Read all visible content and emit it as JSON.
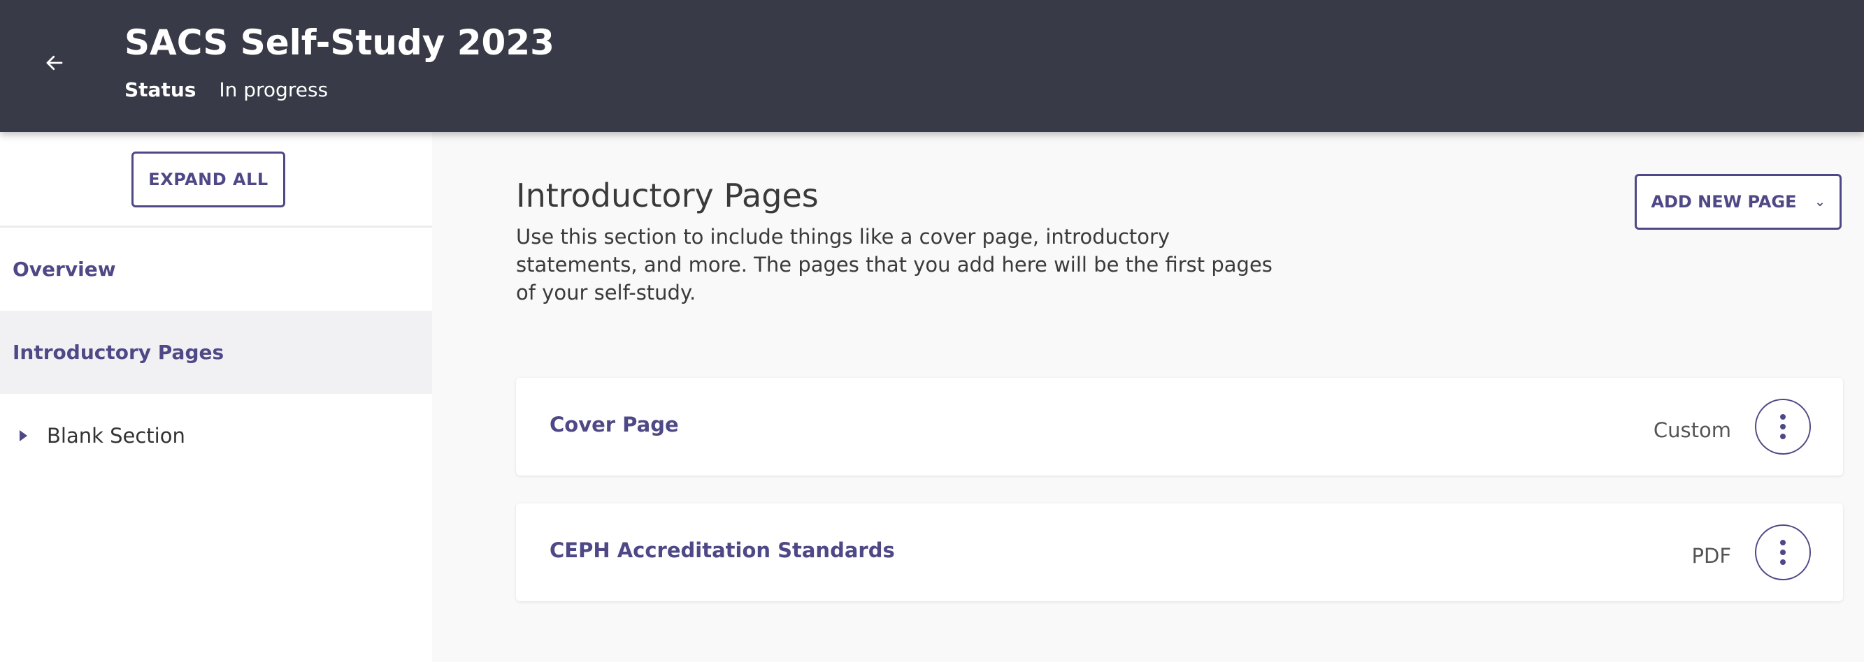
{
  "header": {
    "title": "SACS Self-Study 2023",
    "status_label": "Status",
    "status_value": "In progress"
  },
  "sidebar": {
    "expand_all": "EXPAND ALL",
    "items": [
      {
        "label": "Overview"
      },
      {
        "label": "Introductory Pages"
      },
      {
        "label": "Blank Section"
      }
    ]
  },
  "main": {
    "heading": "Introductory Pages",
    "description": "Use this section to include things like a cover page, introductory statements, and more. The pages that you add here will be the first pages of your self-study.",
    "add_button": "ADD NEW PAGE",
    "pages": [
      {
        "title": "Cover Page",
        "type": "Custom"
      },
      {
        "title": "CEPH Accreditation Standards",
        "type": "PDF"
      }
    ]
  },
  "colors": {
    "header_bg": "#383b47",
    "accent": "#4e4986",
    "page_bg": "#f9f9f9"
  }
}
